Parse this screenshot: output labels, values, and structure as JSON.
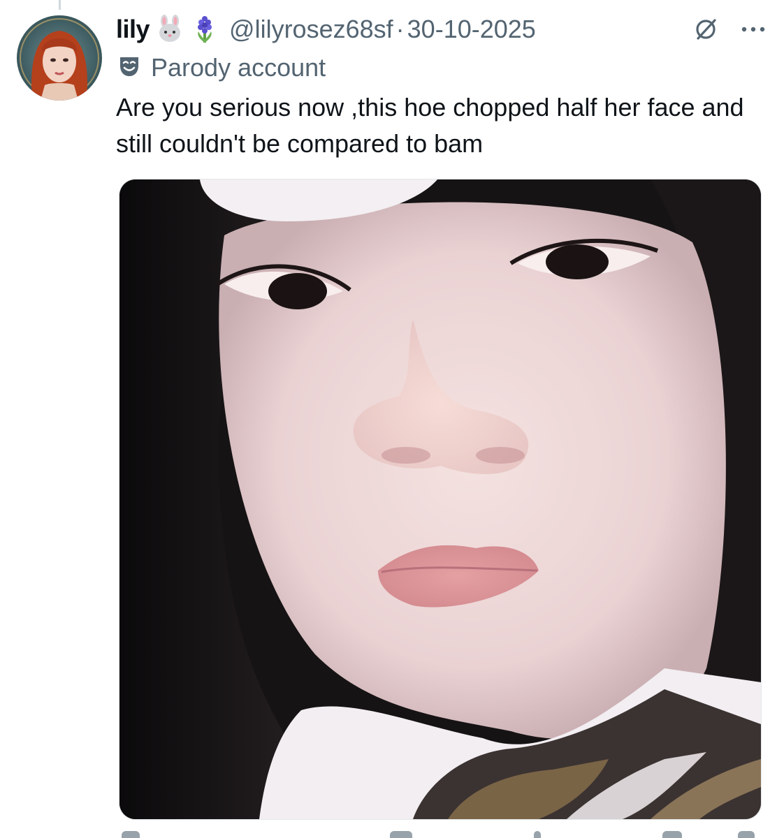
{
  "tweet": {
    "display_name": "lily",
    "name_emojis": [
      "rabbit-face-emoji",
      "hyacinth-emoji"
    ],
    "handle": "@lilyrosez68sf",
    "separator": "·",
    "date": "30-10-2025",
    "label_icon": "theater-masks-icon",
    "label_text": "Parody account",
    "text": "Are you serious now ,this hoe chopped half her face and still couldn't be compared to bam",
    "media_alt": "photo"
  },
  "colors": {
    "text_primary": "#0f1419",
    "text_secondary": "#536471",
    "thread_line": "#cfd9de"
  }
}
